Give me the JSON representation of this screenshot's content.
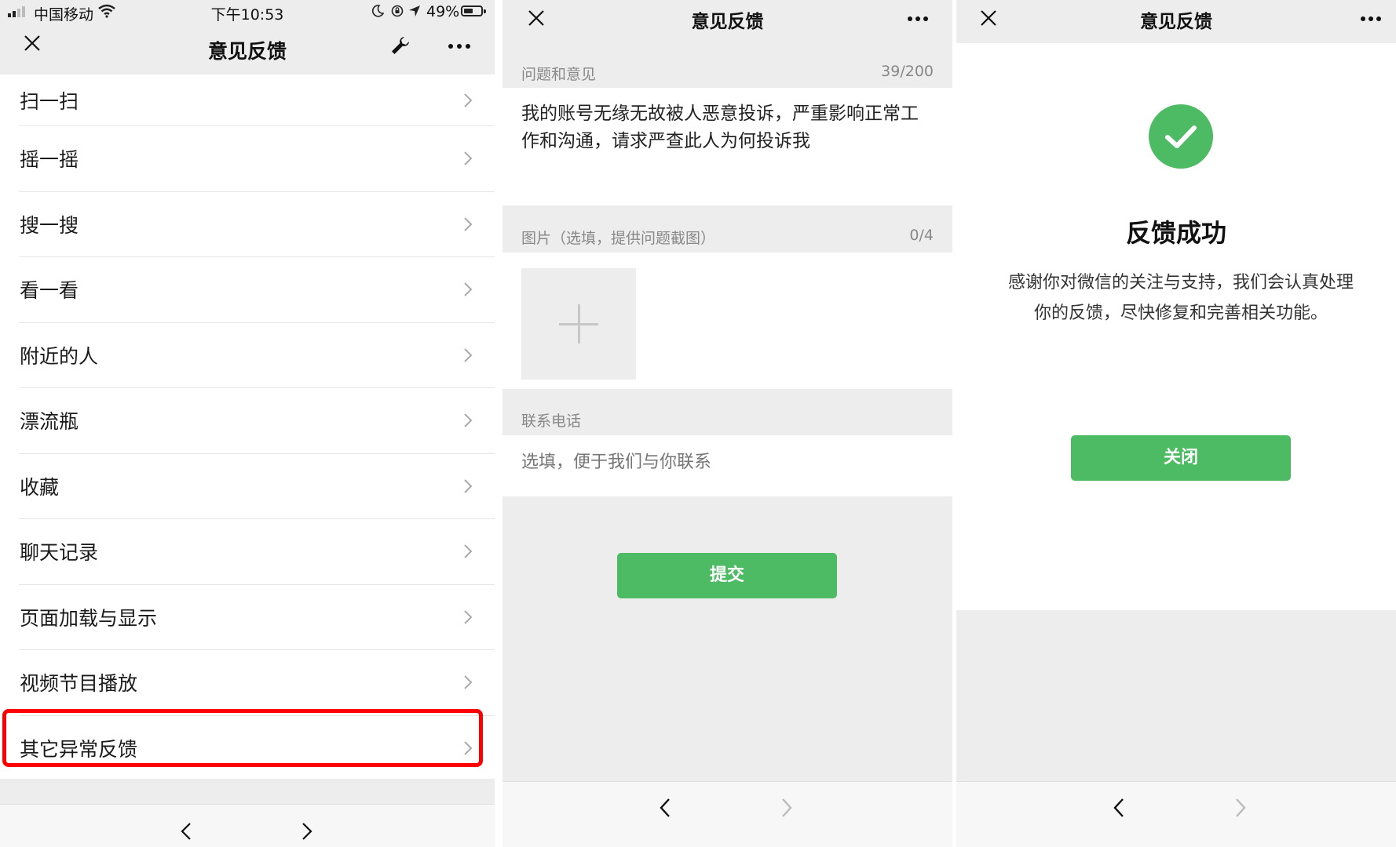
{
  "panel1": {
    "status_bar": {
      "carrier": "中国移动",
      "time": "下午10:53",
      "battery": "49%"
    },
    "nav": {
      "title": "意见反馈"
    },
    "menu_items": [
      {
        "label": "扫一扫"
      },
      {
        "label": "摇一摇"
      },
      {
        "label": "搜一搜"
      },
      {
        "label": "看一看"
      },
      {
        "label": "附近的人"
      },
      {
        "label": "漂流瓶"
      },
      {
        "label": "收藏"
      },
      {
        "label": "聊天记录"
      },
      {
        "label": "页面加载与显示"
      },
      {
        "label": "视频节目播放"
      },
      {
        "label": "其它异常反馈"
      }
    ],
    "highlighted_item": "其它异常反馈",
    "highlight_color": "#ff0000"
  },
  "panel2": {
    "nav": {
      "title": "意见反馈"
    },
    "issue_section": {
      "label": "问题和意见",
      "counter": "39/200"
    },
    "feedback_text": "我的账号无缘无故被人恶意投诉，严重影响正常工作和沟通，请求严查此人为何投诉我",
    "image_section": {
      "label": "图片（选填，提供问题截图）",
      "counter": "0/4"
    },
    "phone_section": {
      "label": "联系电话",
      "placeholder": "选填，便于我们与你联系"
    },
    "submit_label": "提交"
  },
  "panel3": {
    "nav": {
      "title": "意见反馈"
    },
    "success_title": "反馈成功",
    "success_message": "感谢你对微信的关注与支持，我们会认真处理你的反馈，尽快修复和完善相关功能。",
    "close_label": "关闭"
  },
  "colors": {
    "accent_green": "#4dbb63",
    "background_grey": "#ededed"
  },
  "icons": {
    "close": "close-icon",
    "wrench": "wrench-icon",
    "more": "more-icon",
    "chevron": "chevron-right-icon",
    "back": "chevron-left-icon",
    "forward": "chevron-right-icon",
    "check": "check-icon",
    "plus": "plus-icon"
  }
}
